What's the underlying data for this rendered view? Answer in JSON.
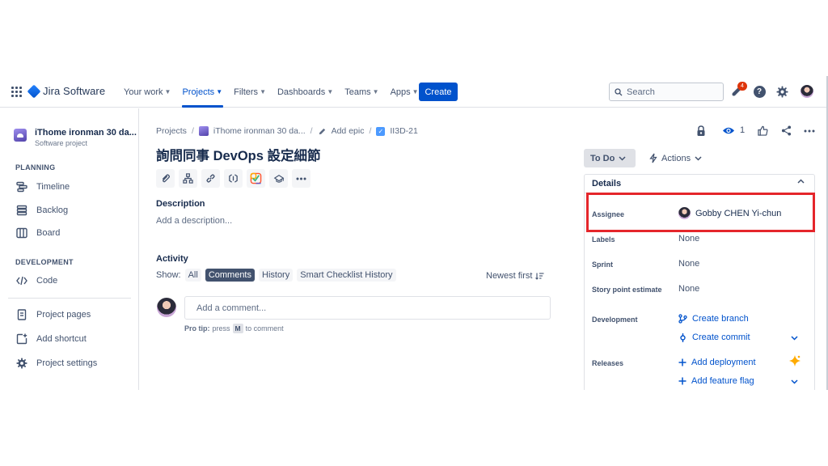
{
  "topnav": {
    "product": "Jira Software",
    "items": [
      {
        "label": "Your work",
        "active": false
      },
      {
        "label": "Projects",
        "active": true
      },
      {
        "label": "Filters",
        "active": false
      },
      {
        "label": "Dashboards",
        "active": false
      },
      {
        "label": "Teams",
        "active": false
      },
      {
        "label": "Apps",
        "active": false
      }
    ],
    "create_label": "Create",
    "search_placeholder": "Search",
    "notification_count": "4"
  },
  "sidebar": {
    "project_name": "iThome ironman 30 da...",
    "project_type": "Software project",
    "planning_heading": "PLANNING",
    "planning_items": [
      "Timeline",
      "Backlog",
      "Board"
    ],
    "development_heading": "DEVELOPMENT",
    "development_items": [
      "Code"
    ],
    "footer_items": [
      "Project pages",
      "Add shortcut",
      "Project settings"
    ]
  },
  "breadcrumb": {
    "projects": "Projects",
    "project": "iThome ironman 30 da...",
    "epic": "Add epic",
    "issue_key": "II3D-21"
  },
  "issue": {
    "title": "詢問同事 DevOps 設定細節",
    "description_label": "Description",
    "description_placeholder": "Add a description...",
    "activity_label": "Activity",
    "show_label": "Show:",
    "activity_filters": [
      {
        "label": "All",
        "selected": false
      },
      {
        "label": "Comments",
        "selected": true
      },
      {
        "label": "History",
        "selected": false
      },
      {
        "label": "Smart Checklist History",
        "selected": false
      }
    ],
    "sort_label": "Newest first",
    "comment_placeholder": "Add a comment...",
    "protip_prefix": "Pro tip:",
    "protip_press": "press",
    "protip_key": "M",
    "protip_suffix": "to comment"
  },
  "header_actions": {
    "watch_count": "1"
  },
  "status": {
    "label": "To Do",
    "actions_label": "Actions"
  },
  "details": {
    "heading": "Details",
    "assignee_label": "Assignee",
    "assignee_value": "Gobby CHEN Yi-chun",
    "labels_label": "Labels",
    "labels_value": "None",
    "sprint_label": "Sprint",
    "sprint_value": "None",
    "story_points_label": "Story point estimate",
    "story_points_value": "None",
    "development_label": "Development",
    "create_branch": "Create branch",
    "create_commit": "Create commit",
    "releases_label": "Releases",
    "add_deployment": "Add deployment",
    "add_feature_flag": "Add feature flag"
  },
  "colors": {
    "brand": "#0052cc",
    "highlight": "#e5262b",
    "badge": "#de350b"
  }
}
